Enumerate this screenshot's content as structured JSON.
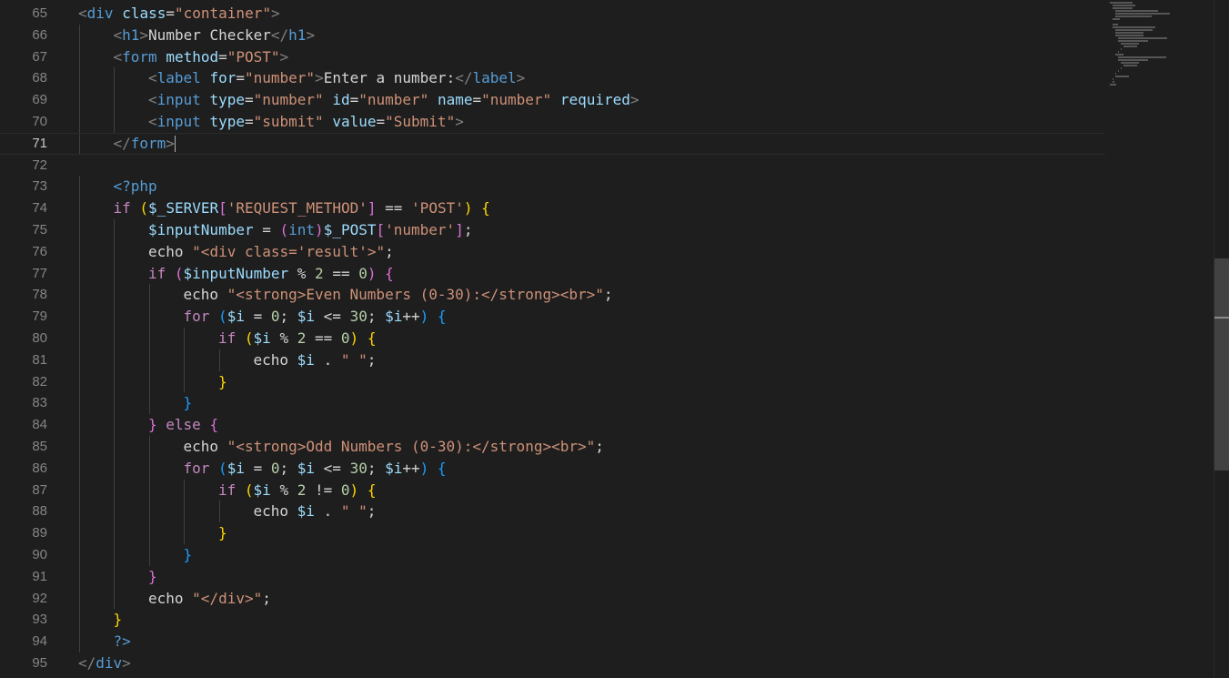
{
  "editor": {
    "active_line": "71",
    "lines": [
      {
        "n": "65",
        "indent": 0,
        "tokens": [
          [
            "t-bracket",
            "<"
          ],
          [
            "t-tag",
            "div"
          ],
          [
            "t-text",
            " "
          ],
          [
            "t-attr",
            "class"
          ],
          [
            "t-text",
            "="
          ],
          [
            "t-str",
            "\"container\""
          ],
          [
            "t-bracket",
            ">"
          ]
        ]
      },
      {
        "n": "66",
        "indent": 1,
        "tokens": [
          [
            "t-bracket",
            "<"
          ],
          [
            "t-tag",
            "h1"
          ],
          [
            "t-bracket",
            ">"
          ],
          [
            "t-text",
            "Number Checker"
          ],
          [
            "t-bracket",
            "</"
          ],
          [
            "t-tag",
            "h1"
          ],
          [
            "t-bracket",
            ">"
          ]
        ]
      },
      {
        "n": "67",
        "indent": 1,
        "tokens": [
          [
            "t-bracket",
            "<"
          ],
          [
            "t-tag",
            "form"
          ],
          [
            "t-text",
            " "
          ],
          [
            "t-attr",
            "method"
          ],
          [
            "t-text",
            "="
          ],
          [
            "t-str",
            "\"POST\""
          ],
          [
            "t-bracket",
            ">"
          ]
        ]
      },
      {
        "n": "68",
        "indent": 2,
        "tokens": [
          [
            "t-bracket",
            "<"
          ],
          [
            "t-tag",
            "label"
          ],
          [
            "t-text",
            " "
          ],
          [
            "t-attr",
            "for"
          ],
          [
            "t-text",
            "="
          ],
          [
            "t-str",
            "\"number\""
          ],
          [
            "t-bracket",
            ">"
          ],
          [
            "t-text",
            "Enter a number:"
          ],
          [
            "t-bracket",
            "</"
          ],
          [
            "t-tag",
            "label"
          ],
          [
            "t-bracket",
            ">"
          ]
        ]
      },
      {
        "n": "69",
        "indent": 2,
        "tokens": [
          [
            "t-bracket",
            "<"
          ],
          [
            "t-tag",
            "input"
          ],
          [
            "t-text",
            " "
          ],
          [
            "t-attr",
            "type"
          ],
          [
            "t-text",
            "="
          ],
          [
            "t-str",
            "\"number\""
          ],
          [
            "t-text",
            " "
          ],
          [
            "t-attr",
            "id"
          ],
          [
            "t-text",
            "="
          ],
          [
            "t-str",
            "\"number\""
          ],
          [
            "t-text",
            " "
          ],
          [
            "t-attr",
            "name"
          ],
          [
            "t-text",
            "="
          ],
          [
            "t-str",
            "\"number\""
          ],
          [
            "t-text",
            " "
          ],
          [
            "t-attr",
            "required"
          ],
          [
            "t-bracket",
            ">"
          ]
        ]
      },
      {
        "n": "70",
        "indent": 2,
        "tokens": [
          [
            "t-bracket",
            "<"
          ],
          [
            "t-tag",
            "input"
          ],
          [
            "t-text",
            " "
          ],
          [
            "t-attr",
            "type"
          ],
          [
            "t-text",
            "="
          ],
          [
            "t-str",
            "\"submit\""
          ],
          [
            "t-text",
            " "
          ],
          [
            "t-attr",
            "value"
          ],
          [
            "t-text",
            "="
          ],
          [
            "t-str",
            "\"Submit\""
          ],
          [
            "t-bracket",
            ">"
          ]
        ]
      },
      {
        "n": "71",
        "indent": 1,
        "tokens": [
          [
            "t-bracket",
            "</"
          ],
          [
            "t-tag",
            "form"
          ],
          [
            "t-bracket",
            ">"
          ]
        ],
        "cursor": true
      },
      {
        "n": "72",
        "indent": 0,
        "tokens": []
      },
      {
        "n": "73",
        "indent": 1,
        "tokens": [
          [
            "t-php",
            "<?php"
          ]
        ]
      },
      {
        "n": "74",
        "indent": 1,
        "tokens": [
          [
            "t-kw",
            "if"
          ],
          [
            "t-text",
            " "
          ],
          [
            "t-b1",
            "("
          ],
          [
            "t-var",
            "$_SERVER"
          ],
          [
            "t-b2",
            "["
          ],
          [
            "t-str",
            "'REQUEST_METHOD'"
          ],
          [
            "t-b2",
            "]"
          ],
          [
            "t-text",
            " == "
          ],
          [
            "t-str",
            "'POST'"
          ],
          [
            "t-b1",
            ")"
          ],
          [
            "t-text",
            " "
          ],
          [
            "t-b1",
            "{"
          ]
        ]
      },
      {
        "n": "75",
        "indent": 2,
        "tokens": [
          [
            "t-var",
            "$inputNumber"
          ],
          [
            "t-text",
            " = "
          ],
          [
            "t-b2",
            "("
          ],
          [
            "t-type",
            "int"
          ],
          [
            "t-b2",
            ")"
          ],
          [
            "t-var",
            "$_POST"
          ],
          [
            "t-b2",
            "["
          ],
          [
            "t-str",
            "'number'"
          ],
          [
            "t-b2",
            "]"
          ],
          [
            "t-text",
            ";"
          ]
        ]
      },
      {
        "n": "76",
        "indent": 2,
        "tokens": [
          [
            "t-text",
            "echo "
          ],
          [
            "t-str",
            "\"<div class='result'>\""
          ],
          [
            "t-text",
            ";"
          ]
        ]
      },
      {
        "n": "77",
        "indent": 2,
        "tokens": [
          [
            "t-kw",
            "if"
          ],
          [
            "t-text",
            " "
          ],
          [
            "t-b2",
            "("
          ],
          [
            "t-var",
            "$inputNumber"
          ],
          [
            "t-text",
            " % "
          ],
          [
            "t-num",
            "2"
          ],
          [
            "t-text",
            " == "
          ],
          [
            "t-num",
            "0"
          ],
          [
            "t-b2",
            ")"
          ],
          [
            "t-text",
            " "
          ],
          [
            "t-b2",
            "{"
          ]
        ]
      },
      {
        "n": "78",
        "indent": 3,
        "tokens": [
          [
            "t-text",
            "echo "
          ],
          [
            "t-str",
            "\"<strong>Even Numbers (0-30):</strong><br>\""
          ],
          [
            "t-text",
            ";"
          ]
        ]
      },
      {
        "n": "79",
        "indent": 3,
        "tokens": [
          [
            "t-kw",
            "for"
          ],
          [
            "t-text",
            " "
          ],
          [
            "t-b3",
            "("
          ],
          [
            "t-var",
            "$i"
          ],
          [
            "t-text",
            " = "
          ],
          [
            "t-num",
            "0"
          ],
          [
            "t-text",
            "; "
          ],
          [
            "t-var",
            "$i"
          ],
          [
            "t-text",
            " <= "
          ],
          [
            "t-num",
            "30"
          ],
          [
            "t-text",
            "; "
          ],
          [
            "t-var",
            "$i"
          ],
          [
            "t-text",
            "++"
          ],
          [
            "t-b3",
            ")"
          ],
          [
            "t-text",
            " "
          ],
          [
            "t-b3",
            "{"
          ]
        ]
      },
      {
        "n": "80",
        "indent": 4,
        "tokens": [
          [
            "t-kw",
            "if"
          ],
          [
            "t-text",
            " "
          ],
          [
            "t-b1",
            "("
          ],
          [
            "t-var",
            "$i"
          ],
          [
            "t-text",
            " % "
          ],
          [
            "t-num",
            "2"
          ],
          [
            "t-text",
            " == "
          ],
          [
            "t-num",
            "0"
          ],
          [
            "t-b1",
            ")"
          ],
          [
            "t-text",
            " "
          ],
          [
            "t-b1",
            "{"
          ]
        ]
      },
      {
        "n": "81",
        "indent": 5,
        "tokens": [
          [
            "t-text",
            "echo "
          ],
          [
            "t-var",
            "$i"
          ],
          [
            "t-text",
            " . "
          ],
          [
            "t-str",
            "\" \""
          ],
          [
            "t-text",
            ";"
          ]
        ]
      },
      {
        "n": "82",
        "indent": 4,
        "tokens": [
          [
            "t-b1",
            "}"
          ]
        ]
      },
      {
        "n": "83",
        "indent": 3,
        "tokens": [
          [
            "t-b3",
            "}"
          ]
        ]
      },
      {
        "n": "84",
        "indent": 2,
        "tokens": [
          [
            "t-b2",
            "}"
          ],
          [
            "t-text",
            " "
          ],
          [
            "t-kw",
            "else"
          ],
          [
            "t-text",
            " "
          ],
          [
            "t-b2",
            "{"
          ]
        ]
      },
      {
        "n": "85",
        "indent": 3,
        "tokens": [
          [
            "t-text",
            "echo "
          ],
          [
            "t-str",
            "\"<strong>Odd Numbers (0-30):</strong><br>\""
          ],
          [
            "t-text",
            ";"
          ]
        ]
      },
      {
        "n": "86",
        "indent": 3,
        "tokens": [
          [
            "t-kw",
            "for"
          ],
          [
            "t-text",
            " "
          ],
          [
            "t-b3",
            "("
          ],
          [
            "t-var",
            "$i"
          ],
          [
            "t-text",
            " = "
          ],
          [
            "t-num",
            "0"
          ],
          [
            "t-text",
            "; "
          ],
          [
            "t-var",
            "$i"
          ],
          [
            "t-text",
            " <= "
          ],
          [
            "t-num",
            "30"
          ],
          [
            "t-text",
            "; "
          ],
          [
            "t-var",
            "$i"
          ],
          [
            "t-text",
            "++"
          ],
          [
            "t-b3",
            ")"
          ],
          [
            "t-text",
            " "
          ],
          [
            "t-b3",
            "{"
          ]
        ]
      },
      {
        "n": "87",
        "indent": 4,
        "tokens": [
          [
            "t-kw",
            "if"
          ],
          [
            "t-text",
            " "
          ],
          [
            "t-b1",
            "("
          ],
          [
            "t-var",
            "$i"
          ],
          [
            "t-text",
            " % "
          ],
          [
            "t-num",
            "2"
          ],
          [
            "t-text",
            " != "
          ],
          [
            "t-num",
            "0"
          ],
          [
            "t-b1",
            ")"
          ],
          [
            "t-text",
            " "
          ],
          [
            "t-b1",
            "{"
          ]
        ]
      },
      {
        "n": "88",
        "indent": 5,
        "tokens": [
          [
            "t-text",
            "echo "
          ],
          [
            "t-var",
            "$i"
          ],
          [
            "t-text",
            " . "
          ],
          [
            "t-str",
            "\" \""
          ],
          [
            "t-text",
            ";"
          ]
        ]
      },
      {
        "n": "89",
        "indent": 4,
        "tokens": [
          [
            "t-b1",
            "}"
          ]
        ]
      },
      {
        "n": "90",
        "indent": 3,
        "tokens": [
          [
            "t-b3",
            "}"
          ]
        ]
      },
      {
        "n": "91",
        "indent": 2,
        "tokens": [
          [
            "t-b2",
            "}"
          ]
        ]
      },
      {
        "n": "92",
        "indent": 2,
        "tokens": [
          [
            "t-text",
            "echo "
          ],
          [
            "t-str",
            "\"</div>\""
          ],
          [
            "t-text",
            ";"
          ]
        ]
      },
      {
        "n": "93",
        "indent": 1,
        "tokens": [
          [
            "t-b1",
            "}"
          ]
        ]
      },
      {
        "n": "94",
        "indent": 1,
        "tokens": [
          [
            "t-php",
            "?>"
          ]
        ]
      },
      {
        "n": "95",
        "indent": 0,
        "tokens": [
          [
            "t-bracket",
            "</"
          ],
          [
            "t-tag",
            "div"
          ],
          [
            "t-bracket",
            ">"
          ]
        ]
      }
    ]
  }
}
